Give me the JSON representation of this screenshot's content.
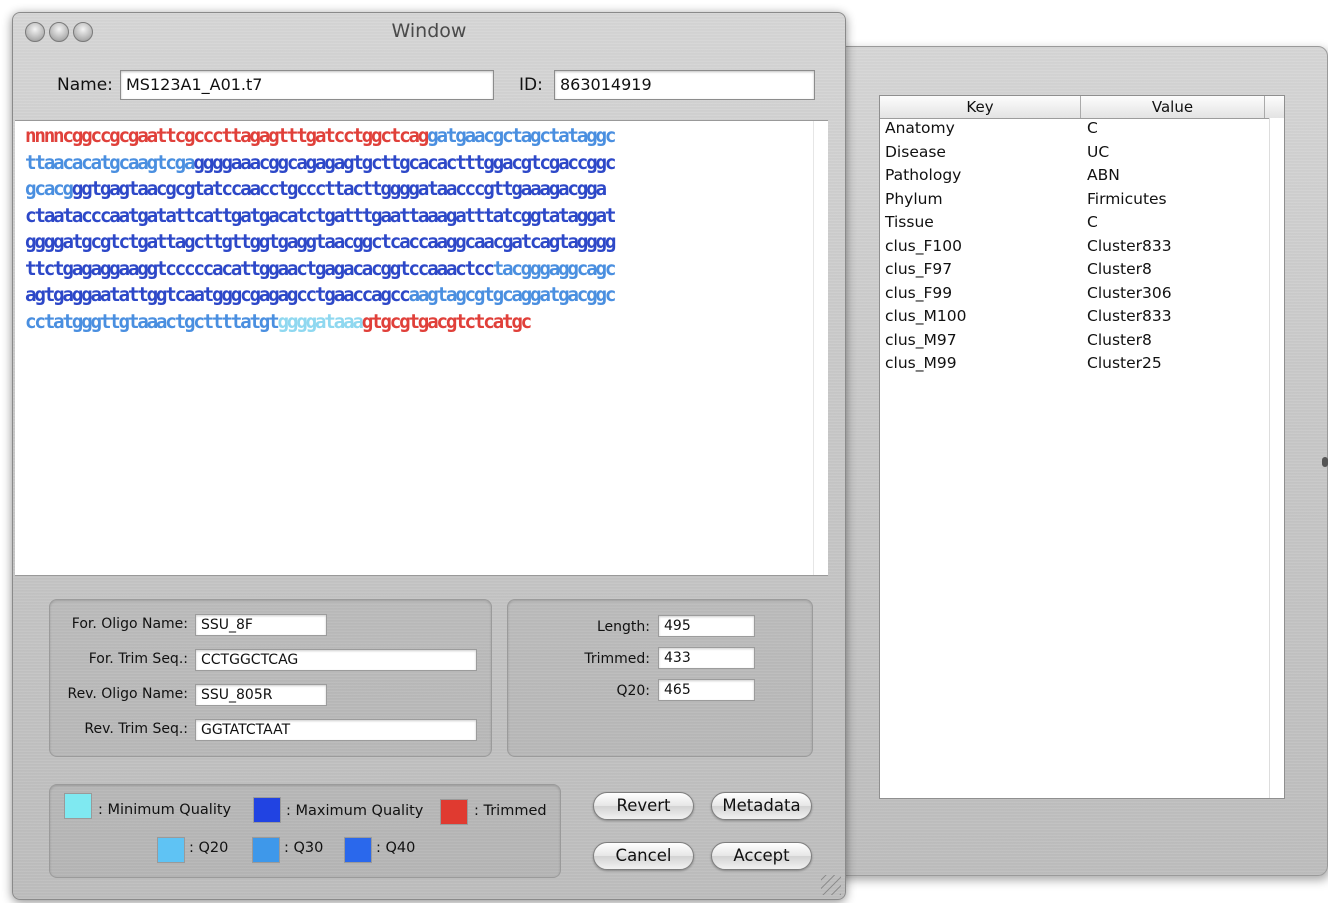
{
  "window": {
    "title": "Window",
    "name_label": "Name:",
    "name_value": "MS123A1_A01.t7",
    "id_label": "ID:",
    "id_value": "863014919"
  },
  "sequence": {
    "lines": [
      [
        {
          "t": "nnnncggccgcgaattcgcccttagagtttgatcctggctcag",
          "c": "T"
        },
        {
          "t": "gatgaacgctagctataggc",
          "c": "L"
        }
      ],
      [
        {
          "t": "ttaacacatgcaagtcga",
          "c": "L"
        },
        {
          "t": "ggggaaacggcagagagtgcttgcacactttggacgtcgaccggc",
          "c": "B"
        }
      ],
      [
        {
          "t": "gcacg",
          "c": "L"
        },
        {
          "t": "ggtgagtaacgcgtatccaacctgcccttacttggggataacccgttgaaagacgga",
          "c": "B"
        }
      ],
      [
        {
          "t": "ctaatacccaatgatattcattgatgacatctgatttgaattaaagatttatcggtataggat",
          "c": "B"
        }
      ],
      [
        {
          "t": "ggggatgcgtctgattagcttgttggtgaggtaacggctcaccaaggcaacgatcagtagggg",
          "c": "B"
        }
      ],
      [
        {
          "t": "ttctgagaggaaggtcccccacattggaactgagacacggtccaaactcc",
          "c": "B"
        },
        {
          "t": "tacgggaggcagc",
          "c": "L"
        }
      ],
      [
        {
          "t": "agtgaggaatattggtcaatgggcgagagcctgaaccagcc",
          "c": "B"
        },
        {
          "t": "aagtagcgtgcaggatgacggc",
          "c": "L"
        }
      ],
      [
        {
          "t": "cctatgggttgtaaactgcttttatgt",
          "c": "L"
        },
        {
          "t": "ggggataaa",
          "c": "C"
        },
        {
          "t": "gtgcgtgacgtctcatgc",
          "c": "T"
        }
      ]
    ]
  },
  "oligo": {
    "for_name_label": "For. Oligo Name:",
    "for_name_value": "SSU_8F",
    "for_trim_label": "For. Trim Seq.:",
    "for_trim_value": "CCTGGCTCAG",
    "rev_name_label": "Rev. Oligo Name:",
    "rev_name_value": "SSU_805R",
    "rev_trim_label": "Rev. Trim Seq.:",
    "rev_trim_value": "GGTATCTAAT"
  },
  "stats": {
    "length_label": "Length:",
    "length_value": "495",
    "trimmed_label": "Trimmed:",
    "trimmed_value": "433",
    "q20_label": "Q20:",
    "q20_value": "465"
  },
  "legend": {
    "min_quality": ": Minimum Quality",
    "max_quality": ": Maximum Quality",
    "trimmed": ": Trimmed",
    "q20": ": Q20",
    "q30": ": Q30",
    "q40": ": Q40",
    "colors": {
      "min_quality": "#7fe9f1",
      "max_quality": "#2143e2",
      "trimmed": "#e03a30",
      "q20": "#5fc3f4",
      "q30": "#3e98ea",
      "q40": "#2a68ec"
    }
  },
  "buttons": {
    "revert": "Revert",
    "metadata": "Metadata",
    "cancel": "Cancel",
    "accept": "Accept"
  },
  "metadata_table": {
    "columns": [
      "Key",
      "Value"
    ],
    "rows": [
      {
        "key": "Anatomy",
        "value": "C"
      },
      {
        "key": "Disease",
        "value": "UC"
      },
      {
        "key": "Pathology",
        "value": "ABN"
      },
      {
        "key": "Phylum",
        "value": "Firmicutes"
      },
      {
        "key": "Tissue",
        "value": "C"
      },
      {
        "key": "clus_F100",
        "value": "Cluster833"
      },
      {
        "key": "clus_F97",
        "value": "Cluster8"
      },
      {
        "key": "clus_F99",
        "value": "Cluster306"
      },
      {
        "key": "clus_M100",
        "value": "Cluster833"
      },
      {
        "key": "clus_M97",
        "value": "Cluster8"
      },
      {
        "key": "clus_M99",
        "value": "Cluster25"
      }
    ]
  }
}
